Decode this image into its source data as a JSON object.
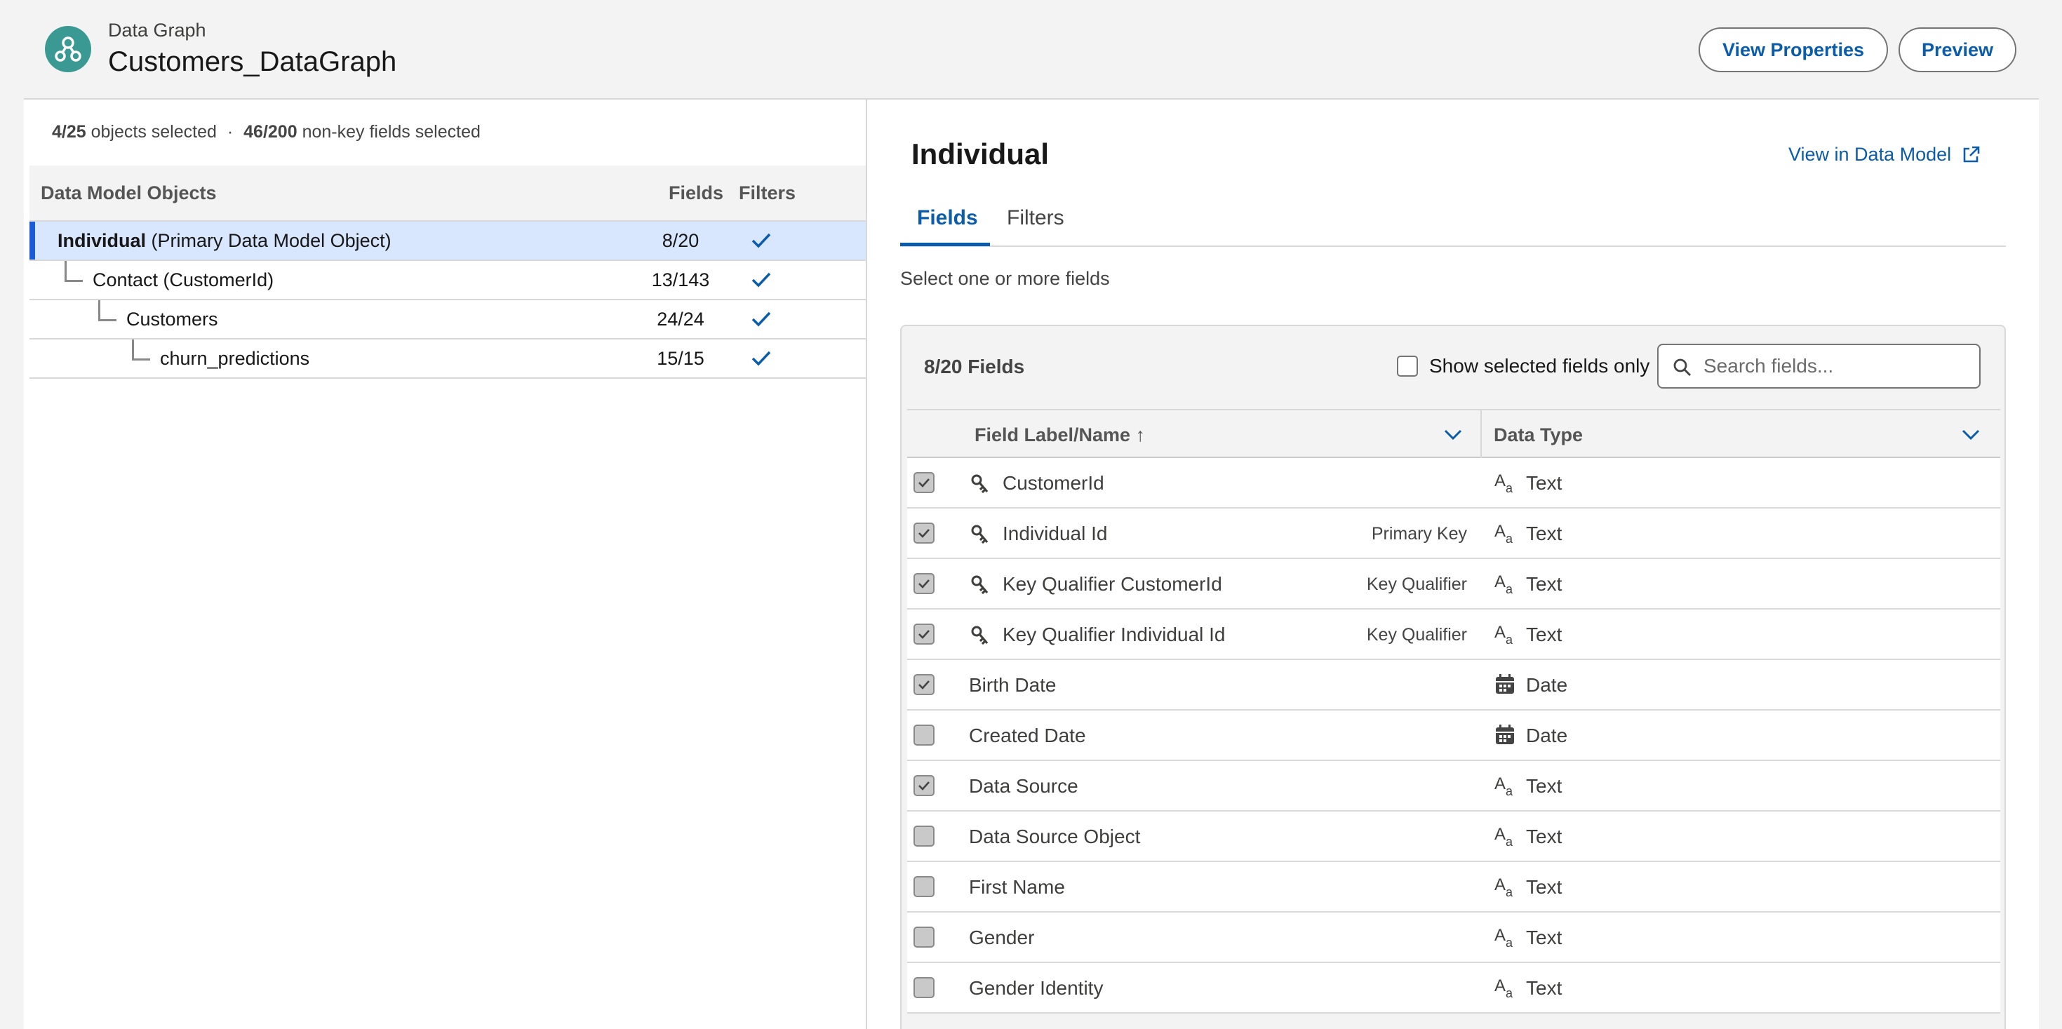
{
  "header": {
    "eyebrow": "Data Graph",
    "title": "Customers_DataGraph",
    "view_properties_label": "View Properties",
    "preview_label": "Preview",
    "icon": "data-graph-icon"
  },
  "left": {
    "summary": {
      "objects_count": "4/25",
      "objects_text": "objects selected",
      "separator": "·",
      "fields_count": "46/200",
      "fields_text": "non-key fields selected"
    },
    "columns": {
      "objects": "Data Model Objects",
      "fields": "Fields",
      "filters": "Filters"
    },
    "objects": [
      {
        "name": "Individual",
        "suffix": " (Primary Data Model Object)",
        "fields": "8/20",
        "filters": "check-icon",
        "selected": true
      },
      {
        "name": "Contact (CustomerId)",
        "suffix": "",
        "fields": "13/143",
        "filters": "check-icon",
        "selected": false
      },
      {
        "name": "Customers",
        "suffix": "",
        "fields": "24/24",
        "filters": "check-icon",
        "selected": false
      },
      {
        "name": "churn_predictions",
        "suffix": "",
        "fields": "15/15",
        "filters": "check-icon",
        "selected": false
      }
    ]
  },
  "right": {
    "title": "Individual",
    "view_in_model": "View in Data Model",
    "tabs": [
      {
        "label": "Fields",
        "active": true
      },
      {
        "label": "Filters",
        "active": false
      }
    ],
    "hint": "Select one or more fields",
    "fields_count": "8/20 Fields",
    "show_selected_label": "Show selected fields only",
    "show_selected_checked": false,
    "search_placeholder": "Search fields...",
    "columns": {
      "label": "Field Label/Name",
      "sort_indicator": "↑",
      "type": "Data Type"
    },
    "fields": [
      {
        "label": "CustomerId",
        "key": true,
        "tag": "",
        "type": "Text",
        "checked": true
      },
      {
        "label": "Individual Id",
        "key": true,
        "tag": "Primary Key",
        "type": "Text",
        "checked": true
      },
      {
        "label": "Key Qualifier CustomerId",
        "key": true,
        "tag": "Key Qualifier",
        "type": "Text",
        "checked": true
      },
      {
        "label": "Key Qualifier Individual Id",
        "key": true,
        "tag": "Key Qualifier",
        "type": "Text",
        "checked": true
      },
      {
        "label": "Birth Date",
        "key": false,
        "tag": "",
        "type": "Date",
        "checked": true
      },
      {
        "label": "Created Date",
        "key": false,
        "tag": "",
        "type": "Date",
        "checked": false
      },
      {
        "label": "Data Source",
        "key": false,
        "tag": "",
        "type": "Text",
        "checked": true
      },
      {
        "label": "Data Source Object",
        "key": false,
        "tag": "",
        "type": "Text",
        "checked": false
      },
      {
        "label": "First Name",
        "key": false,
        "tag": "",
        "type": "Text",
        "checked": false
      },
      {
        "label": "Gender",
        "key": false,
        "tag": "",
        "type": "Text",
        "checked": false
      },
      {
        "label": "Gender Identity",
        "key": false,
        "tag": "",
        "type": "Text",
        "checked": false
      }
    ]
  },
  "colors": {
    "brand_blue": "#0b5cab",
    "selected_row": "#d8e6fe",
    "app_icon": "#3a9a93"
  }
}
